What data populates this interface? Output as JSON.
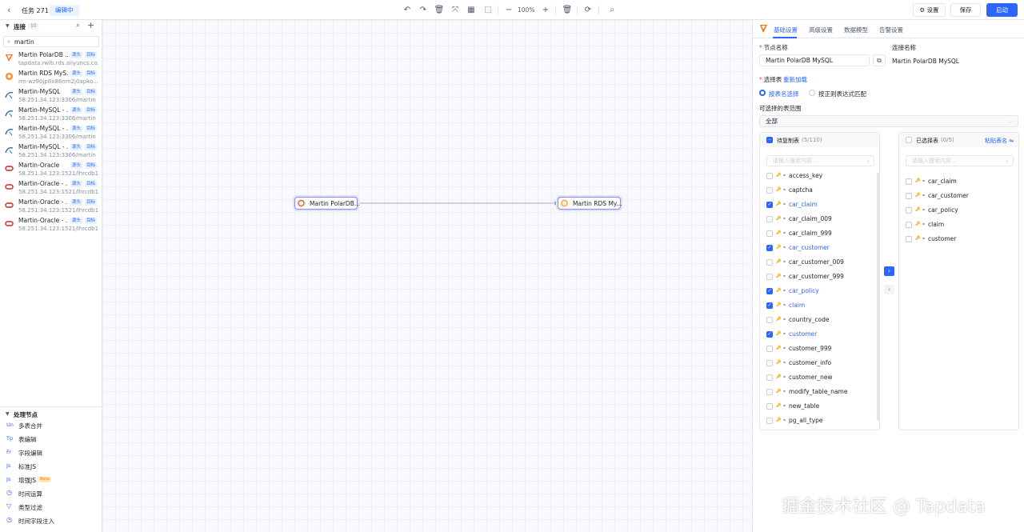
{
  "header": {
    "back_icon": "chevron-left-icon",
    "title": "任务 271",
    "status_badge": "编辑中",
    "zoom": "100%",
    "settings_label": "设置",
    "save_label": "保存",
    "start_label": "启动"
  },
  "sidebar": {
    "connections_title": "连接",
    "connections_count": "10",
    "search_value": "martin",
    "connections": [
      {
        "name": "Martin PolarDB ...",
        "tags": [
          "源头",
          "目标"
        ],
        "host": "tapdata.rwlb.rds.aliyuncs.co...",
        "icon": "polardb-icon"
      },
      {
        "name": "Martin RDS MyS...",
        "tags": [
          "源头",
          "目标"
        ],
        "host": "rm-wz90jp8x86nm2j0apko...",
        "icon": "rds-icon"
      },
      {
        "name": "Martin-MySQL",
        "tags": [
          "源头",
          "目标"
        ],
        "host": "58.251.34.123:3306/martin",
        "icon": "mysql-icon"
      },
      {
        "name": "Martin-MySQL - ...",
        "tags": [
          "源头",
          "目标"
        ],
        "host": "58.251.34.123:3306/martin",
        "icon": "mysql-icon"
      },
      {
        "name": "Martin-MySQL - ...",
        "tags": [
          "源头",
          "目标"
        ],
        "host": "58.251.34.123:3306/martin",
        "icon": "mysql-icon"
      },
      {
        "name": "Martin-MySQL - ...",
        "tags": [
          "源头",
          "目标"
        ],
        "host": "58.251.34.123:3306/martin",
        "icon": "mysql-icon"
      },
      {
        "name": "Martin-Oracle",
        "tags": [
          "源头",
          "目标"
        ],
        "host": "58.251.34.123:1521/lhrcdb1/...",
        "icon": "oracle-icon"
      },
      {
        "name": "Martin-Oracle - ...",
        "tags": [
          "源头",
          "目标"
        ],
        "host": "58.251.34.123:1521/lhrcdb1/...",
        "icon": "oracle-icon"
      },
      {
        "name": "Martin-Oracle - ...",
        "tags": [
          "源头",
          "目标"
        ],
        "host": "58.251.34.123:1521/lhrcdb1/...",
        "icon": "oracle-icon"
      },
      {
        "name": "Martin-Oracle - ...",
        "tags": [
          "源头",
          "目标"
        ],
        "host": "58.251.34.123:1521/lhrcdb1/...",
        "icon": "oracle-icon"
      }
    ],
    "process_title": "处理节点",
    "process_nodes": [
      {
        "icon": "Un",
        "label": "多表合并"
      },
      {
        "icon": "Tp",
        "label": "表编辑"
      },
      {
        "icon": "Fr",
        "label": "字段编辑"
      },
      {
        "icon": "Js",
        "label": "标准JS"
      },
      {
        "icon": "Js",
        "label": "增强JS",
        "badge": "Beta"
      },
      {
        "icon": "clock-icon",
        "label": "时间运算"
      },
      {
        "icon": "filter-icon",
        "label": "类型过滤"
      },
      {
        "icon": "clock-icon",
        "label": "时间字段注入"
      }
    ]
  },
  "canvas": {
    "nodes": [
      {
        "label": "Martin PolarDB..."
      },
      {
        "label": "Martin RDS My..."
      }
    ]
  },
  "panel": {
    "tabs": [
      "基础设置",
      "高级设置",
      "数据模型",
      "告警设置"
    ],
    "active_tab": 0,
    "node_name_label": "节点名称",
    "node_name_value": "Martin PolarDB MySQL",
    "connection_name_label": "连接名称",
    "connection_name_value": "Martin PolarDB MySQL",
    "select_table_label": "选择表",
    "reload_label": "重新加载",
    "mode_options": [
      "按表名选择",
      "按正则表达式匹配"
    ],
    "selected_mode": 0,
    "scope_label": "可选择的表范围",
    "scope_value": "全部",
    "source_list": {
      "title": "待复制表",
      "count": "(5/110)",
      "search_placeholder": "请输入搜索内容...",
      "tables": [
        {
          "name": "access_key",
          "checked": false
        },
        {
          "name": "captcha",
          "checked": false
        },
        {
          "name": "car_claim",
          "checked": true
        },
        {
          "name": "car_claim_009",
          "checked": false
        },
        {
          "name": "car_claim_999",
          "checked": false
        },
        {
          "name": "car_customer",
          "checked": true
        },
        {
          "name": "car_customer_009",
          "checked": false
        },
        {
          "name": "car_customer_999",
          "checked": false
        },
        {
          "name": "car_policy",
          "checked": true
        },
        {
          "name": "claim",
          "checked": true
        },
        {
          "name": "country_code",
          "checked": false
        },
        {
          "name": "customer",
          "checked": true
        },
        {
          "name": "customer_999",
          "checked": false
        },
        {
          "name": "customer_info",
          "checked": false
        },
        {
          "name": "customer_new",
          "checked": false
        },
        {
          "name": "modify_table_name",
          "checked": false
        },
        {
          "name": "new_table",
          "checked": false
        },
        {
          "name": "pg_all_type",
          "checked": false
        }
      ]
    },
    "target_list": {
      "title": "已选择表",
      "count": "(0/5)",
      "paste_label": "粘贴表名",
      "search_placeholder": "请输入搜索内容...",
      "tables": [
        "car_claim",
        "car_customer",
        "car_policy",
        "claim",
        "customer"
      ]
    }
  },
  "watermark": "掘金技术社区 @ Tapdata",
  "colors": {
    "accent": "#2c65ff",
    "node_border": "#8c8cf5"
  }
}
